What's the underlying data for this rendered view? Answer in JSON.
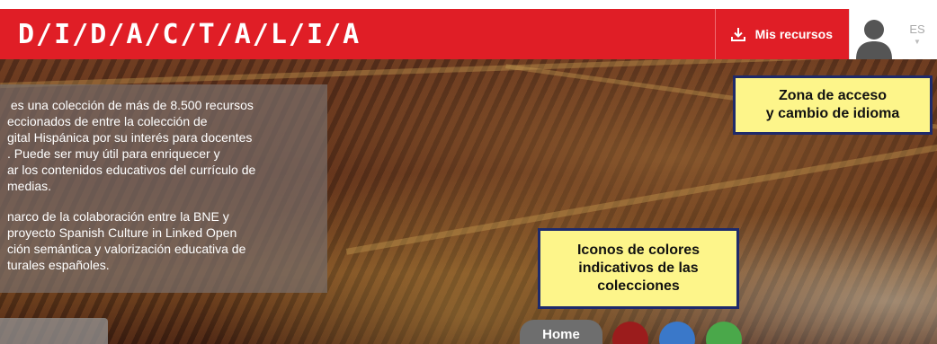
{
  "header": {
    "logo": "D/I/D/A/C/T/A/L/I/A",
    "my_resources_label": "Mis recursos",
    "language": "ES",
    "brand_color": "#e01e26"
  },
  "hero": {
    "info_paragraphs": [
      " es una colección de más de 8.500 recursos\neccionados de entre la colección de\ngital Hispánica por su interés para docentes\n. Puede ser muy útil para enriquecer y\nar los contenidos educativos del currículo de\nmedias.",
      "narco de la colaboración entre la BNE y\nproyecto Spanish Culture in Linked Open\nción semántica y valorización educativa de\nturales españoles."
    ],
    "home_label": "Home",
    "collection_colors": [
      "#9b1c1c",
      "#3a78c9",
      "#4aa84a"
    ]
  },
  "annotations": {
    "access_zone": "Zona de acceso\ny cambio de idioma",
    "color_icons": "Iconos de colores\nindicativos de las\ncolecciones"
  },
  "icons": [
    "download-icon",
    "user-avatar-icon",
    "chevron-down-icon"
  ]
}
